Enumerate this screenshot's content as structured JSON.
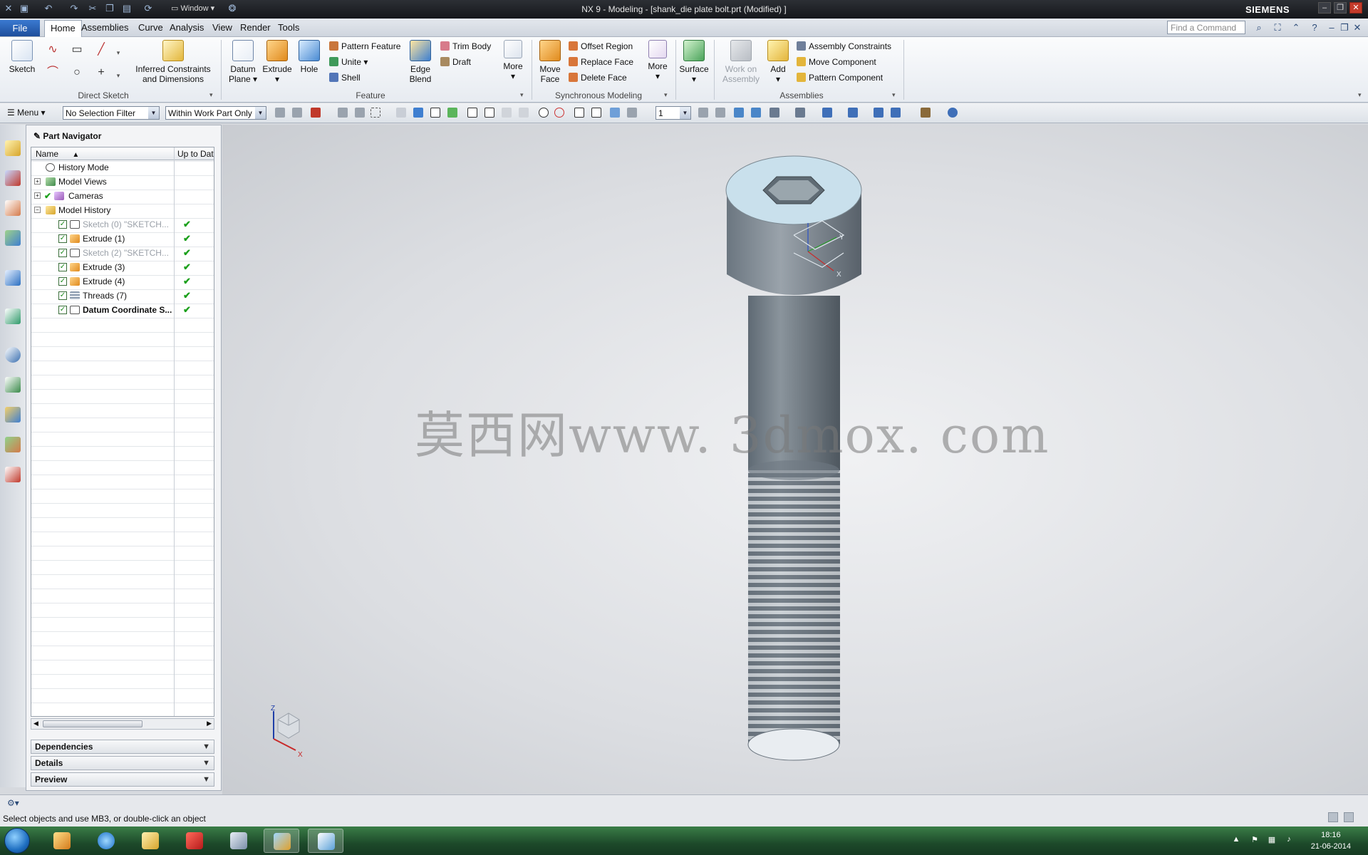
{
  "window": {
    "title": "NX 9 - Modeling - [shank_die plate bolt.prt (Modified) ]",
    "brand": "SIEMENS",
    "quick_window_label": "Window"
  },
  "menubar": {
    "file": "File",
    "tabs": [
      "Home",
      "Assemblies",
      "Curve",
      "Analysis",
      "View",
      "Render",
      "Tools"
    ],
    "find_placeholder": "Find a Command"
  },
  "ribbon": {
    "sketch": "Sketch",
    "inferred_l1": "Inferred Constraints",
    "inferred_l2": "and Dimensions",
    "direct_sketch": "Direct Sketch",
    "datum_l1": "Datum",
    "datum_l2": "Plane",
    "extrude": "Extrude",
    "hole": "Hole",
    "pattern_feature": "Pattern Feature",
    "unite": "Unite",
    "shell": "Shell",
    "edge_l1": "Edge",
    "edge_l2": "Blend",
    "trim_body": "Trim Body",
    "draft": "Draft",
    "more": "More",
    "feature": "Feature",
    "move_l1": "Move",
    "move_l2": "Face",
    "offset_region": "Offset Region",
    "replace_face": "Replace Face",
    "delete_face": "Delete Face",
    "more2": "More",
    "synchronous": "Synchronous Modeling",
    "surface": "Surface",
    "work_l1": "Work on",
    "work_l2": "Assembly",
    "add": "Add",
    "assembly_constraints": "Assembly Constraints",
    "move_component": "Move Component",
    "pattern_component": "Pattern Component",
    "assemblies": "Assemblies"
  },
  "toolbar2": {
    "menu": "Menu",
    "selection_filter": "No Selection Filter",
    "scope": "Within Work Part Only",
    "layer": "1"
  },
  "navigator": {
    "title": "Part Navigator",
    "col_name": "Name",
    "col_up": "Up to Dat",
    "rows": [
      {
        "label": "History Mode"
      },
      {
        "label": "Model Views"
      },
      {
        "label": "Cameras"
      },
      {
        "label": "Model History"
      },
      {
        "label": "Sketch (0) \"SKETCH..."
      },
      {
        "label": "Extrude (1)"
      },
      {
        "label": "Sketch (2) \"SKETCH..."
      },
      {
        "label": "Extrude (3)"
      },
      {
        "label": "Extrude (4)"
      },
      {
        "label": "Threads (7)"
      },
      {
        "label": "Datum Coordinate S..."
      }
    ],
    "ok_mark": "✔",
    "panels": [
      "Dependencies",
      "Details",
      "Preview"
    ]
  },
  "viewport": {
    "watermark": "莫西网www. 3dmox. com",
    "axis_y": "Y",
    "axis_x": "X",
    "triad_z": "Z",
    "triad_x": "X"
  },
  "status": {
    "text": "Select objects and use MB3, or double-click an object"
  },
  "taskbar": {
    "time": "18:16",
    "date": "21-06-2014"
  }
}
